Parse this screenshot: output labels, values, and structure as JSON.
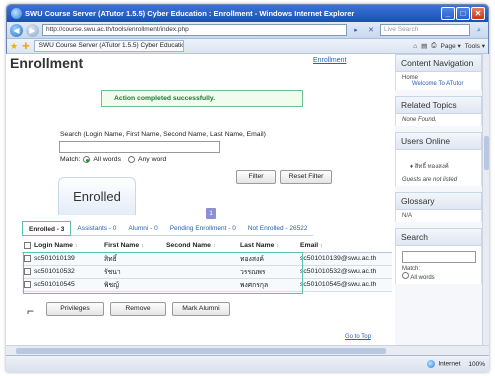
{
  "window": {
    "title": "SWU Course Server (ATutor 1.5.5) Cyber Education : Enrollment - Windows Internet Explorer",
    "minimize": "_",
    "maximize": "□",
    "close": "✕"
  },
  "addressbar": {
    "url": "http://course.swu.ac.th/tools/enrollment/index.php",
    "search_placeholder": "Live Search",
    "go": "▸",
    "x": "✕"
  },
  "favorites": {
    "tab_title": "SWU Course Server (ATutor 1.5.5) Cyber Education ...",
    "page_menu": "Page ▾",
    "tools_menu": "Tools ▾"
  },
  "page": {
    "heading": "Enrollment",
    "user_links": "Enrollment",
    "feedback": "Action completed successfully.",
    "search_label": "Search (Login Name, First Name, Second Name, Last Name, Email)",
    "match_label": "Match:",
    "match_all": "All words",
    "match_any": "Any word",
    "filter_button": "Filter",
    "reset_button": "Reset Filter",
    "enrolled_heading": "Enrolled",
    "page_number": "1",
    "tabs": [
      {
        "label": "Enrolled - 3"
      },
      {
        "label": "Assistants - 0"
      },
      {
        "label": "Alumni - 0"
      },
      {
        "label": "Pending Enrollment - 0"
      },
      {
        "label": "Not Enrolled - 26522"
      }
    ],
    "table": {
      "headers": [
        "Login Name",
        "First Name",
        "Second Name",
        "Last Name",
        "Email"
      ],
      "rows": [
        {
          "login": "sc501010139",
          "first": "สิทธิ์",
          "second": "",
          "last": "ทองสงค์",
          "email": "sc501010139@swu.ac.th"
        },
        {
          "login": "sc501010532",
          "first": "รัชนา",
          "second": "",
          "last": "วรรณพร",
          "email": "sc501010532@swu.ac.th"
        },
        {
          "login": "sc501010545",
          "first": "พิชญ์",
          "second": "",
          "last": "พงศกรกุล",
          "email": "sc501010545@swu.ac.th"
        }
      ]
    },
    "actions": {
      "privileges": "Privileges",
      "remove": "Remove",
      "mark_alumni": "Mark Alumni"
    },
    "goto_top": "Go to Top"
  },
  "sidebar": {
    "content_nav": {
      "title": "Content Navigation",
      "home": "Home",
      "link": "Welcome To ATutor"
    },
    "related": {
      "title": "Related Topics",
      "text": "None Found."
    },
    "online": {
      "title": "Users Online",
      "user": "สิทธิ์ ทองสงค์",
      "note": "Guests are not listed"
    },
    "glossary": {
      "title": "Glossary",
      "text": "N/A"
    },
    "search": {
      "title": "Search",
      "match": "Match:",
      "all_words": "All words"
    }
  },
  "statusbar": {
    "zone": "Internet",
    "zoom": "100%"
  },
  "colors": {
    "titlebar": "#1a4fb4",
    "success_border": "#6ac48b",
    "highlight": "#5ec1b0",
    "link": "#2a5fb0"
  }
}
